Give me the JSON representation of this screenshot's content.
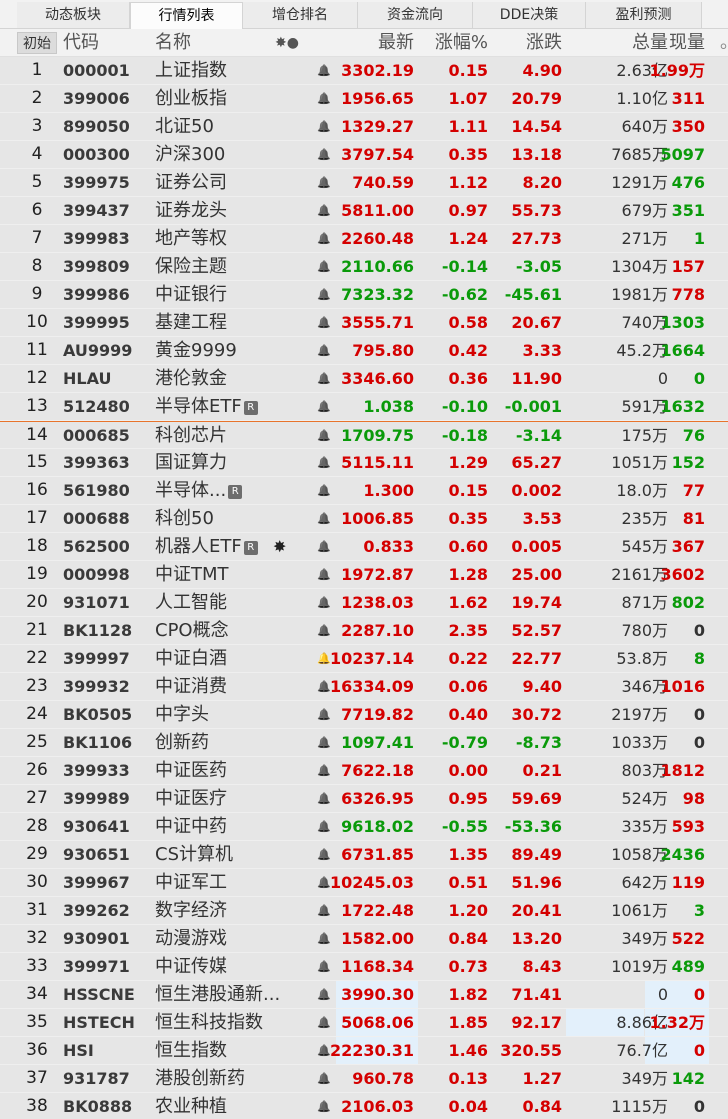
{
  "tabs": [
    "动态板块",
    "行情列表",
    "增仓排名",
    "资金流向",
    "DDE决策",
    "盈利预测"
  ],
  "header": {
    "init": "初始",
    "code": "代码",
    "name": "名称",
    "marks": "✸●",
    "price": "最新",
    "pct": "涨幅%",
    "chg": "涨跌",
    "volume": "总量",
    "current": "现量",
    "extra": "。"
  },
  "colors": {
    "up": "#d40000",
    "down": "#0a9a0a",
    "highlight": "#e3f0fb",
    "separator": "#e8742c"
  },
  "rows": [
    {
      "idx": "1",
      "code": "000001",
      "name": "上证指数",
      "badge": "",
      "star": "",
      "bell": "normal",
      "price": "3302.19",
      "pct": "0.15",
      "chg": "4.90",
      "dir": "up",
      "volume": "2.63亿",
      "current": "1.99万",
      "cur_dir": "up"
    },
    {
      "idx": "2",
      "code": "399006",
      "name": "创业板指",
      "badge": "",
      "star": "",
      "bell": "normal",
      "price": "1956.65",
      "pct": "1.07",
      "chg": "20.79",
      "dir": "up",
      "volume": "1.10亿",
      "current": "311",
      "cur_dir": "up"
    },
    {
      "idx": "3",
      "code": "899050",
      "name": "北证50",
      "badge": "",
      "star": "",
      "bell": "normal",
      "price": "1329.27",
      "pct": "1.11",
      "chg": "14.54",
      "dir": "up",
      "volume": "640万",
      "current": "350",
      "cur_dir": "up"
    },
    {
      "idx": "4",
      "code": "000300",
      "name": "沪深300",
      "badge": "",
      "star": "",
      "bell": "normal",
      "price": "3797.54",
      "pct": "0.35",
      "chg": "13.18",
      "dir": "up",
      "volume": "7685万",
      "current": "5097",
      "cur_dir": "down"
    },
    {
      "idx": "5",
      "code": "399975",
      "name": "证券公司",
      "badge": "",
      "star": "",
      "bell": "normal",
      "price": "740.59",
      "pct": "1.12",
      "chg": "8.20",
      "dir": "up",
      "volume": "1291万",
      "current": "476",
      "cur_dir": "down"
    },
    {
      "idx": "6",
      "code": "399437",
      "name": "证券龙头",
      "badge": "",
      "star": "",
      "bell": "normal",
      "price": "5811.00",
      "pct": "0.97",
      "chg": "55.73",
      "dir": "up",
      "volume": "679万",
      "current": "351",
      "cur_dir": "down"
    },
    {
      "idx": "7",
      "code": "399983",
      "name": "地产等权",
      "badge": "",
      "star": "",
      "bell": "normal",
      "price": "2260.48",
      "pct": "1.24",
      "chg": "27.73",
      "dir": "up",
      "volume": "271万",
      "current": "1",
      "cur_dir": "down"
    },
    {
      "idx": "8",
      "code": "399809",
      "name": "保险主题",
      "badge": "",
      "star": "",
      "bell": "normal",
      "price": "2110.66",
      "pct": "-0.14",
      "chg": "-3.05",
      "dir": "down",
      "volume": "1304万",
      "current": "157",
      "cur_dir": "up"
    },
    {
      "idx": "9",
      "code": "399986",
      "name": "中证银行",
      "badge": "",
      "star": "",
      "bell": "normal",
      "price": "7323.32",
      "pct": "-0.62",
      "chg": "-45.61",
      "dir": "down",
      "volume": "1981万",
      "current": "778",
      "cur_dir": "up"
    },
    {
      "idx": "10",
      "code": "399995",
      "name": "基建工程",
      "badge": "",
      "star": "",
      "bell": "normal",
      "price": "3555.71",
      "pct": "0.58",
      "chg": "20.67",
      "dir": "up",
      "volume": "740万",
      "current": "1303",
      "cur_dir": "down"
    },
    {
      "idx": "11",
      "code": "AU9999",
      "name": "黄金9999",
      "badge": "",
      "star": "",
      "bell": "normal",
      "price": "795.80",
      "pct": "0.42",
      "chg": "3.33",
      "dir": "up",
      "volume": "45.2万",
      "current": "1664",
      "cur_dir": "down"
    },
    {
      "idx": "12",
      "code": "HLAU",
      "name": "港伦敦金",
      "badge": "",
      "star": "",
      "bell": "normal",
      "price": "3346.60",
      "pct": "0.36",
      "chg": "11.90",
      "dir": "up",
      "volume": "0",
      "current": "0",
      "cur_dir": "down"
    },
    {
      "idx": "13",
      "code": "512480",
      "name": "半导体ETF",
      "badge": "R",
      "star": "",
      "bell": "normal",
      "price": "1.038",
      "pct": "-0.10",
      "chg": "-0.001",
      "dir": "down",
      "volume": "591万",
      "current": "1632",
      "cur_dir": "down"
    },
    {
      "idx": "14",
      "code": "000685",
      "name": "科创芯片",
      "badge": "",
      "star": "",
      "bell": "normal",
      "price": "1709.75",
      "pct": "-0.18",
      "chg": "-3.14",
      "dir": "down",
      "volume": "175万",
      "current": "76",
      "cur_dir": "down",
      "sep": true
    },
    {
      "idx": "15",
      "code": "399363",
      "name": "国证算力",
      "badge": "",
      "star": "",
      "bell": "normal",
      "price": "5115.11",
      "pct": "1.29",
      "chg": "65.27",
      "dir": "up",
      "volume": "1051万",
      "current": "152",
      "cur_dir": "down"
    },
    {
      "idx": "16",
      "code": "561980",
      "name": "半导体...",
      "badge": "R",
      "star": "",
      "bell": "normal",
      "price": "1.300",
      "pct": "0.15",
      "chg": "0.002",
      "dir": "up",
      "volume": "18.0万",
      "current": "77",
      "cur_dir": "up"
    },
    {
      "idx": "17",
      "code": "000688",
      "name": "科创50",
      "badge": "",
      "star": "",
      "bell": "normal",
      "price": "1006.85",
      "pct": "0.35",
      "chg": "3.53",
      "dir": "up",
      "volume": "235万",
      "current": "81",
      "cur_dir": "up"
    },
    {
      "idx": "18",
      "code": "562500",
      "name": "机器人ETF",
      "badge": "R",
      "star": "✸",
      "bell": "normal",
      "price": "0.833",
      "pct": "0.60",
      "chg": "0.005",
      "dir": "up",
      "volume": "545万",
      "current": "367",
      "cur_dir": "up"
    },
    {
      "idx": "19",
      "code": "000998",
      "name": "中证TMT",
      "badge": "",
      "star": "",
      "bell": "normal",
      "price": "1972.87",
      "pct": "1.28",
      "chg": "25.00",
      "dir": "up",
      "volume": "2161万",
      "current": "3602",
      "cur_dir": "up"
    },
    {
      "idx": "20",
      "code": "931071",
      "name": "人工智能",
      "badge": "",
      "star": "",
      "bell": "normal",
      "price": "1238.03",
      "pct": "1.62",
      "chg": "19.74",
      "dir": "up",
      "volume": "871万",
      "current": "802",
      "cur_dir": "down"
    },
    {
      "idx": "21",
      "code": "BK1128",
      "name": "CPO概念",
      "badge": "",
      "star": "",
      "bell": "normal",
      "price": "2287.10",
      "pct": "2.35",
      "chg": "52.57",
      "dir": "up",
      "volume": "780万",
      "current": "0",
      "cur_dir": "flat"
    },
    {
      "idx": "22",
      "code": "399997",
      "name": "中证白酒",
      "badge": "",
      "star": "",
      "bell": "hot",
      "price": "10237.14",
      "pct": "0.22",
      "chg": "22.77",
      "dir": "up",
      "volume": "53.8万",
      "current": "8",
      "cur_dir": "down"
    },
    {
      "idx": "23",
      "code": "399932",
      "name": "中证消费",
      "badge": "",
      "star": "",
      "bell": "normal",
      "price": "16334.09",
      "pct": "0.06",
      "chg": "9.40",
      "dir": "up",
      "volume": "346万",
      "current": "1016",
      "cur_dir": "up"
    },
    {
      "idx": "24",
      "code": "BK0505",
      "name": "中字头",
      "badge": "",
      "star": "",
      "bell": "normal",
      "price": "7719.82",
      "pct": "0.40",
      "chg": "30.72",
      "dir": "up",
      "volume": "2197万",
      "current": "0",
      "cur_dir": "flat"
    },
    {
      "idx": "25",
      "code": "BK1106",
      "name": "创新药",
      "badge": "",
      "star": "",
      "bell": "normal",
      "price": "1097.41",
      "pct": "-0.79",
      "chg": "-8.73",
      "dir": "down",
      "volume": "1033万",
      "current": "0",
      "cur_dir": "flat"
    },
    {
      "idx": "26",
      "code": "399933",
      "name": "中证医药",
      "badge": "",
      "star": "",
      "bell": "normal",
      "price": "7622.18",
      "pct": "0.00",
      "chg": "0.21",
      "dir": "up",
      "volume": "803万",
      "current": "1812",
      "cur_dir": "up"
    },
    {
      "idx": "27",
      "code": "399989",
      "name": "中证医疗",
      "badge": "",
      "star": "",
      "bell": "normal",
      "price": "6326.95",
      "pct": "0.95",
      "chg": "59.69",
      "dir": "up",
      "volume": "524万",
      "current": "98",
      "cur_dir": "up"
    },
    {
      "idx": "28",
      "code": "930641",
      "name": "中证中药",
      "badge": "",
      "star": "",
      "bell": "normal",
      "price": "9618.02",
      "pct": "-0.55",
      "chg": "-53.36",
      "dir": "down",
      "volume": "335万",
      "current": "593",
      "cur_dir": "up"
    },
    {
      "idx": "29",
      "code": "930651",
      "name": "CS计算机",
      "badge": "",
      "star": "",
      "bell": "normal",
      "price": "6731.85",
      "pct": "1.35",
      "chg": "89.49",
      "dir": "up",
      "volume": "1058万",
      "current": "2436",
      "cur_dir": "down"
    },
    {
      "idx": "30",
      "code": "399967",
      "name": "中证军工",
      "badge": "",
      "star": "",
      "bell": "normal",
      "price": "10245.03",
      "pct": "0.51",
      "chg": "51.96",
      "dir": "up",
      "volume": "642万",
      "current": "119",
      "cur_dir": "up"
    },
    {
      "idx": "31",
      "code": "399262",
      "name": "数字经济",
      "badge": "",
      "star": "",
      "bell": "normal",
      "price": "1722.48",
      "pct": "1.20",
      "chg": "20.41",
      "dir": "up",
      "volume": "1061万",
      "current": "3",
      "cur_dir": "down"
    },
    {
      "idx": "32",
      "code": "930901",
      "name": "动漫游戏",
      "badge": "",
      "star": "",
      "bell": "normal",
      "price": "1582.00",
      "pct": "0.84",
      "chg": "13.20",
      "dir": "up",
      "volume": "349万",
      "current": "522",
      "cur_dir": "up"
    },
    {
      "idx": "33",
      "code": "399971",
      "name": "中证传媒",
      "badge": "",
      "star": "",
      "bell": "normal",
      "price": "1168.34",
      "pct": "0.73",
      "chg": "8.43",
      "dir": "up",
      "volume": "1019万",
      "current": "489",
      "cur_dir": "down"
    },
    {
      "idx": "34",
      "code": "HSSCNE",
      "name": "恒生港股通新...",
      "badge": "",
      "star": "",
      "bell": "normal",
      "price": "3990.30",
      "pct": "1.82",
      "chg": "71.41",
      "dir": "up",
      "volume": "0",
      "current": "0",
      "cur_dir": "up",
      "hl_price": true,
      "hl_cur": true
    },
    {
      "idx": "35",
      "code": "HSTECH",
      "name": "恒生科技指数",
      "badge": "",
      "star": "",
      "bell": "normal",
      "price": "5068.06",
      "pct": "1.85",
      "chg": "92.17",
      "dir": "up",
      "volume": "8.86亿",
      "current": "1.32万",
      "cur_dir": "up",
      "hl_price": true,
      "hl_vol": true,
      "hl_cur": true
    },
    {
      "idx": "36",
      "code": "HSI",
      "name": "恒生指数",
      "badge": "",
      "star": "",
      "bell": "normal",
      "price": "22230.31",
      "pct": "1.46",
      "chg": "320.55",
      "dir": "up",
      "volume": "76.7亿",
      "current": "0",
      "cur_dir": "up",
      "hl_price": true,
      "hl_cur": true
    },
    {
      "idx": "37",
      "code": "931787",
      "name": "港股创新药",
      "badge": "",
      "star": "",
      "bell": "normal",
      "price": "960.78",
      "pct": "0.13",
      "chg": "1.27",
      "dir": "up",
      "volume": "349万",
      "current": "142",
      "cur_dir": "down"
    },
    {
      "idx": "38",
      "code": "BK0888",
      "name": "农业种植",
      "badge": "",
      "star": "",
      "bell": "normal",
      "price": "2106.03",
      "pct": "0.04",
      "chg": "0.84",
      "dir": "up",
      "volume": "1115万",
      "current": "0",
      "cur_dir": "flat"
    }
  ]
}
